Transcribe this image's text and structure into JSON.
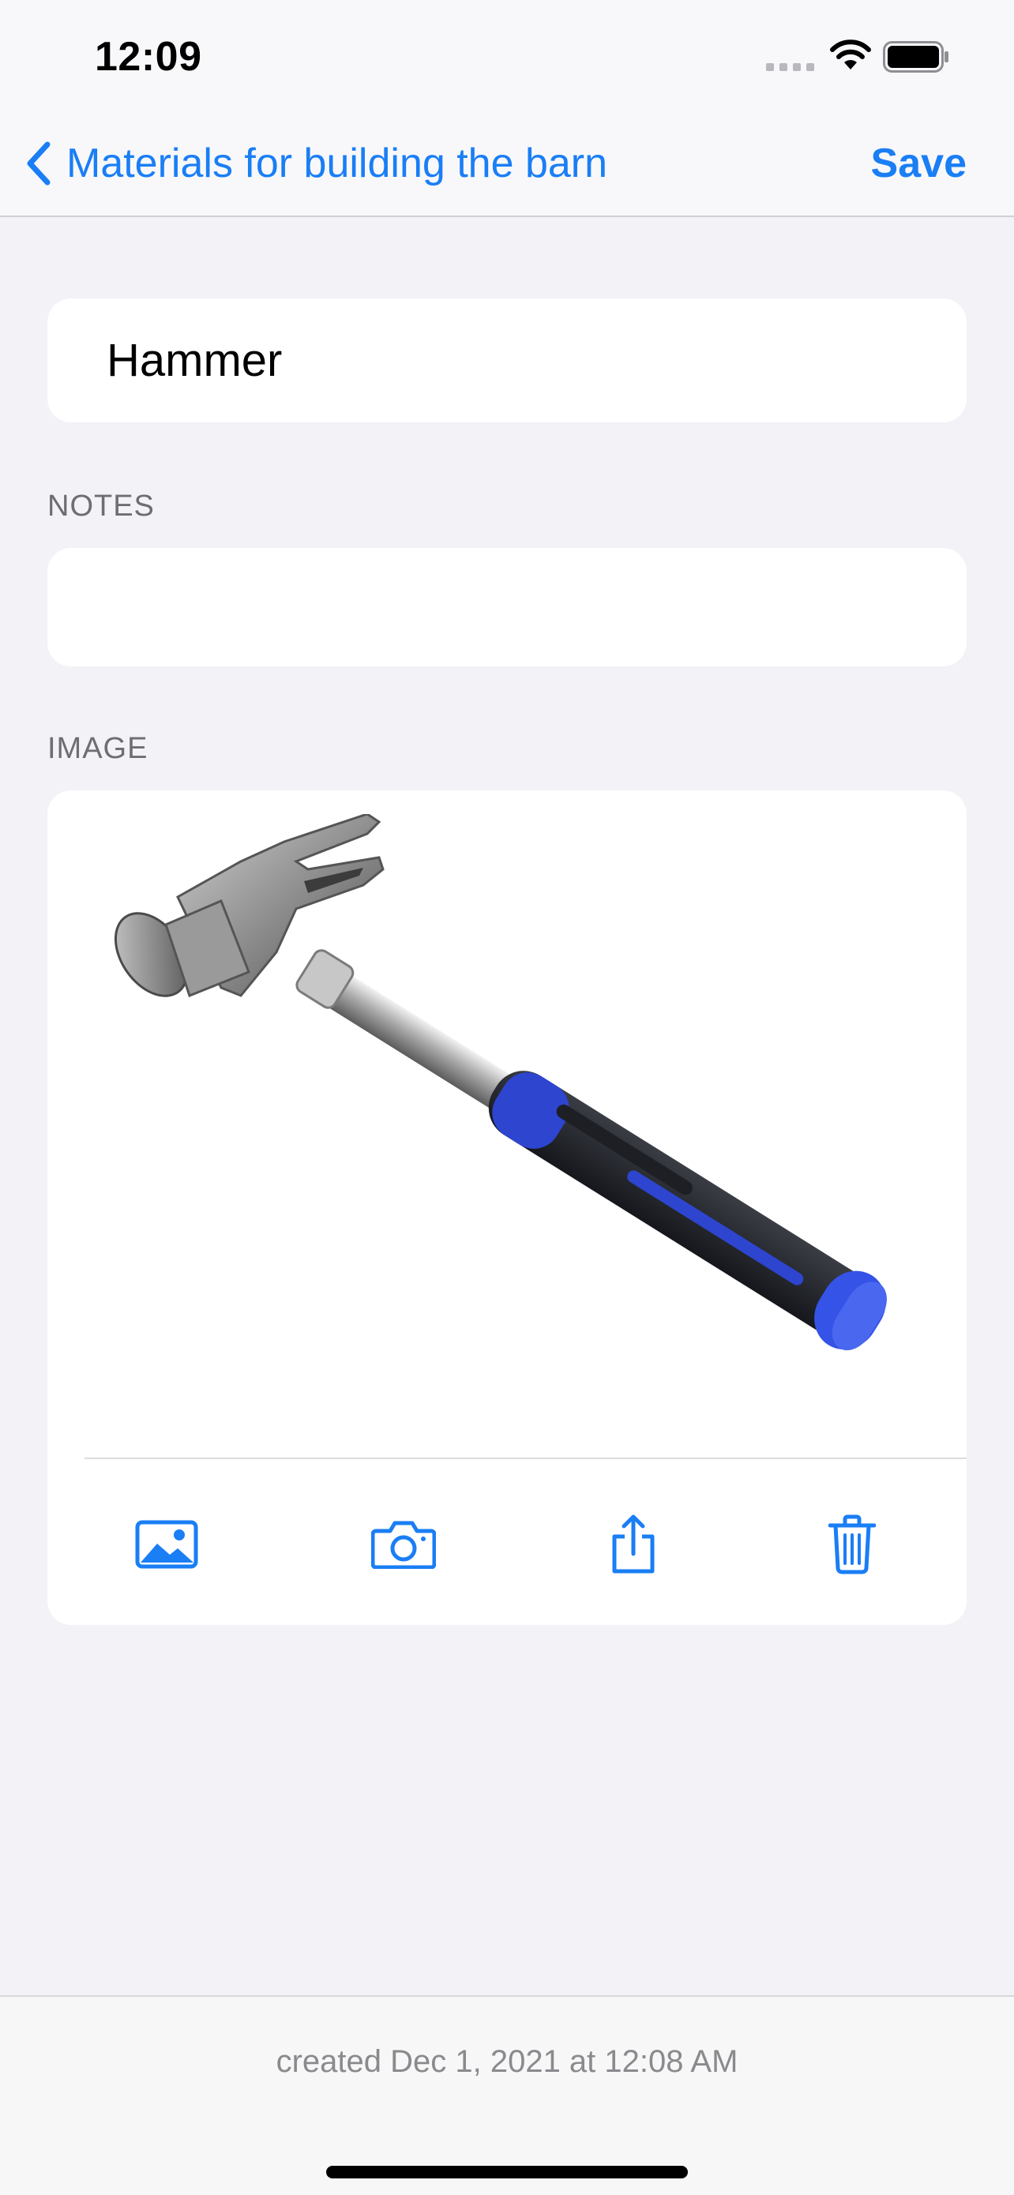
{
  "status_bar": {
    "time": "12:09"
  },
  "nav": {
    "back_label": "Materials for building the barn",
    "save_label": "Save"
  },
  "item": {
    "title": "Hammer"
  },
  "notes": {
    "label": "NOTES",
    "value": ""
  },
  "image_section": {
    "label": "IMAGE",
    "toolbar": [
      "photo-icon",
      "camera-icon",
      "share-icon",
      "trash-icon"
    ]
  },
  "footer": {
    "created": "created Dec 1, 2021 at 12:08 AM"
  },
  "colors": {
    "accent": "#1a7ef5",
    "background": "#f2f2f7"
  }
}
